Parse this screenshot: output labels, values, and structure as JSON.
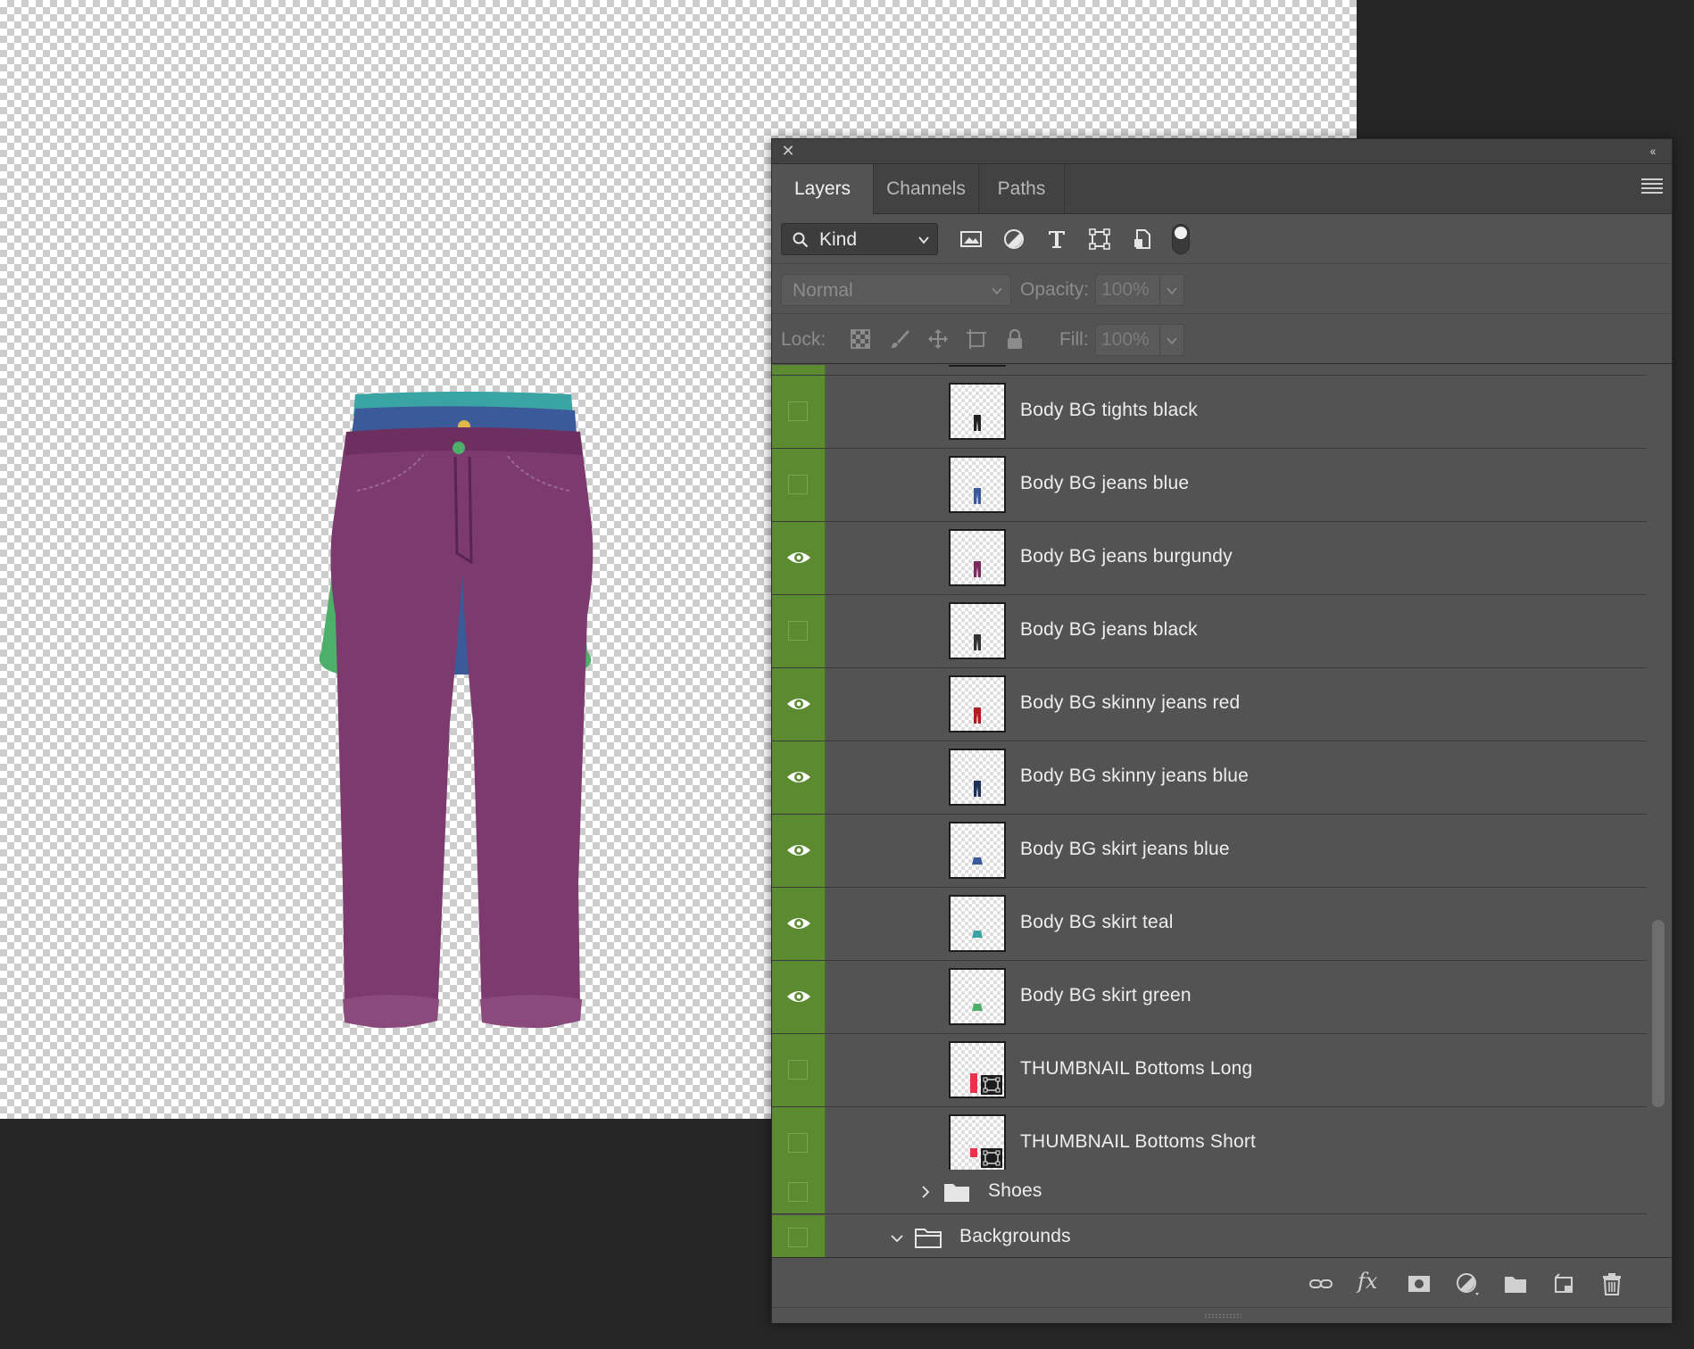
{
  "panel": {
    "close_glyph": "✕",
    "collapse_glyph": "‹‹",
    "tabs": [
      {
        "label": "Layers",
        "active": true
      },
      {
        "label": "Channels",
        "active": false
      },
      {
        "label": "Paths",
        "active": false
      }
    ],
    "filter": {
      "kind_label": "Kind",
      "icons": [
        "pixel-filter-icon",
        "adjustment-filter-icon",
        "type-filter-icon",
        "shape-filter-icon",
        "smart-object-filter-icon"
      ]
    },
    "blend": {
      "mode": "Normal",
      "opacity_label": "Opacity:",
      "opacity_value": "100%",
      "fill_label": "Fill:",
      "fill_value": "100%"
    },
    "lock": {
      "label": "Lock:",
      "icons": [
        "lock-transparent-icon",
        "lock-pixels-icon",
        "lock-position-icon",
        "lock-artboard-icon",
        "lock-all-icon"
      ]
    }
  },
  "colors": {
    "visibility_column": "#5b8a31",
    "panel_bg": "#535353",
    "canvas_check": "#cccccc"
  },
  "layers": [
    {
      "name": "Body BG tights black",
      "visible": false,
      "thumb_color": "#222222",
      "thumb_shape": "pants"
    },
    {
      "name": "Body BG jeans blue",
      "visible": false,
      "thumb_color": "#3a5a9a",
      "thumb_shape": "pants"
    },
    {
      "name": "Body BG jeans burgundy",
      "visible": true,
      "thumb_color": "#7a2a5c",
      "thumb_shape": "pants"
    },
    {
      "name": "Body BG jeans black",
      "visible": false,
      "thumb_color": "#333333",
      "thumb_shape": "pants"
    },
    {
      "name": "Body BG skinny jeans red",
      "visible": true,
      "thumb_color": "#b01c22",
      "thumb_shape": "pants"
    },
    {
      "name": "Body BG skinny jeans blue",
      "visible": true,
      "thumb_color": "#1f2f55",
      "thumb_shape": "pants"
    },
    {
      "name": "Body BG skirt jeans blue",
      "visible": true,
      "thumb_color": "#3a5a9a",
      "thumb_shape": "skirt"
    },
    {
      "name": "Body BG skirt teal",
      "visible": true,
      "thumb_color": "#3aa3a3",
      "thumb_shape": "skirt"
    },
    {
      "name": "Body BG skirt green",
      "visible": true,
      "thumb_color": "#4caf6a",
      "thumb_shape": "skirt"
    },
    {
      "name": "THUMBNAIL Bottoms Long",
      "visible": false,
      "thumb_color": "#e8324a",
      "thumb_shape": "smart-long"
    },
    {
      "name": "THUMBNAIL Bottoms Short",
      "visible": false,
      "thumb_color": "#e8324a",
      "thumb_shape": "smart-short"
    }
  ],
  "groups": [
    {
      "name": "Shoes",
      "expanded": false
    },
    {
      "name": "Backgrounds",
      "expanded": true
    }
  ],
  "bottom_icons": [
    "link-layers-icon",
    "fx-icon",
    "add-mask-icon",
    "adjustment-layer-icon",
    "new-group-icon",
    "new-layer-icon",
    "trash-icon"
  ],
  "fx_glyph": "fx"
}
